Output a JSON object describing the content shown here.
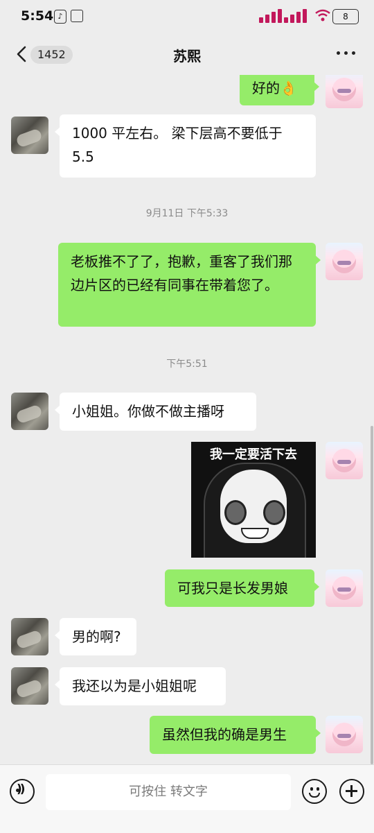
{
  "status_bar": {
    "time": "5:54",
    "battery": "8",
    "tiktok_glyph": "♪"
  },
  "header": {
    "unread_count": "1452",
    "title": "苏熙"
  },
  "messages": [
    {
      "side": "right",
      "text": "好的👌"
    },
    {
      "side": "left",
      "text": "1000 平左右。 梁下层高不要低于 5.5"
    },
    {
      "type": "time",
      "text": "9月11日 下午5:33"
    },
    {
      "side": "right",
      "text": "老板推不了了，抱歉，重客了我们那边片区的已经有同事在带着您了。"
    },
    {
      "type": "time",
      "text": "下午5:51"
    },
    {
      "side": "left",
      "text": "小姐姐。你做不做主播呀"
    },
    {
      "side": "right",
      "type": "sticker",
      "caption": "我一定要活下去"
    },
    {
      "side": "right",
      "text": "可我只是长发男娘"
    },
    {
      "side": "left",
      "text": "男的啊?"
    },
    {
      "side": "left",
      "text": "我还以为是小姐姐呢"
    },
    {
      "side": "right",
      "text": "虽然但我的确是男生"
    }
  ],
  "input_bar": {
    "hold_to_talk": "可按住 转文字"
  },
  "colors": {
    "background": "#ededed",
    "self_bubble": "#95ec69",
    "other_bubble": "#ffffff"
  }
}
